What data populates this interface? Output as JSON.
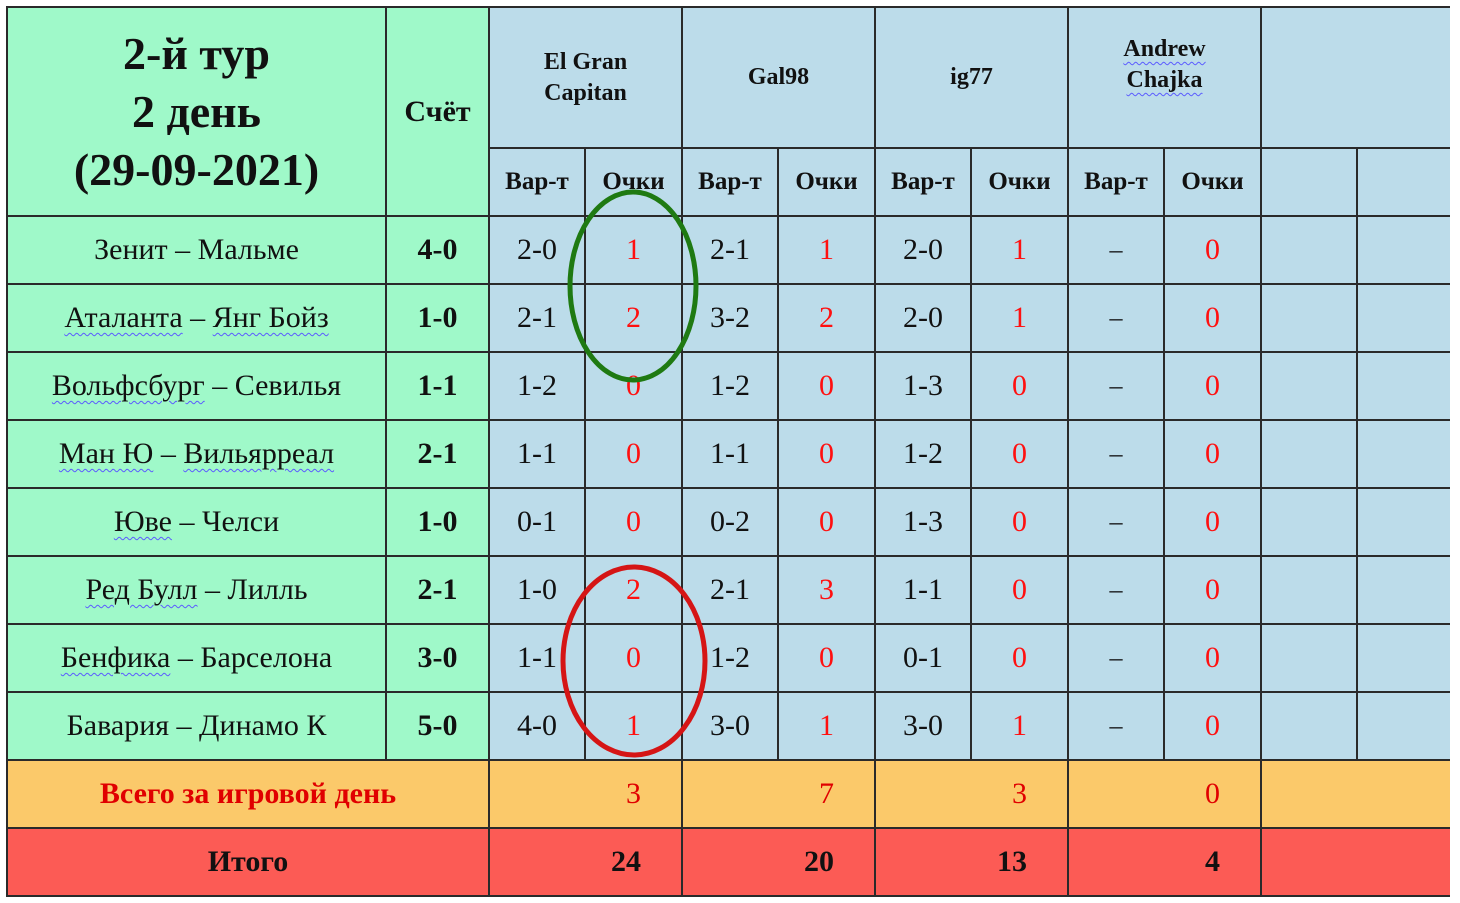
{
  "header": {
    "title_lines": [
      "2-й тур",
      "2 день",
      "(29-09-2021)"
    ],
    "score_label": "Счёт",
    "pred_label": "Вар-т",
    "points_label": "Очки"
  },
  "players": [
    {
      "name_lines": [
        "El Gran",
        "Capitan"
      ],
      "wavy": false
    },
    {
      "name_lines": [
        "Gal98"
      ],
      "wavy": false
    },
    {
      "name_lines": [
        "ig77"
      ],
      "wavy": false
    },
    {
      "name_lines": [
        "Andrew",
        "Chajka"
      ],
      "wavy": true
    }
  ],
  "matches": [
    {
      "home": "Зенит",
      "away": "Мальме",
      "score": "4-0",
      "wavy": [],
      "picks": [
        {
          "p": "2-0",
          "pts": "1"
        },
        {
          "p": "2-1",
          "pts": "1"
        },
        {
          "p": "2-0",
          "pts": "1"
        },
        {
          "p": "–",
          "pts": "0"
        }
      ]
    },
    {
      "home": "Аталанта",
      "away": "Янг Бойз",
      "score": "1-0",
      "wavy": [
        "home",
        "away"
      ],
      "picks": [
        {
          "p": "2-1",
          "pts": "2"
        },
        {
          "p": "3-2",
          "pts": "2"
        },
        {
          "p": "2-0",
          "pts": "1"
        },
        {
          "p": "–",
          "pts": "0"
        }
      ]
    },
    {
      "home": "Вольфсбург",
      "away": "Севилья",
      "score": "1-1",
      "wavy": [
        "home"
      ],
      "picks": [
        {
          "p": "1-2",
          "pts": "0"
        },
        {
          "p": "1-2",
          "pts": "0"
        },
        {
          "p": "1-3",
          "pts": "0"
        },
        {
          "p": "–",
          "pts": "0"
        }
      ]
    },
    {
      "home": "Ман Ю",
      "away": "Вильярреал",
      "score": "2-1",
      "wavy": [
        "home",
        "away"
      ],
      "picks": [
        {
          "p": "1-1",
          "pts": "0"
        },
        {
          "p": "1-1",
          "pts": "0"
        },
        {
          "p": "1-2",
          "pts": "0"
        },
        {
          "p": "–",
          "pts": "0"
        }
      ]
    },
    {
      "home": "Юве",
      "away": "Челси",
      "score": "1-0",
      "wavy": [
        "home"
      ],
      "picks": [
        {
          "p": "0-1",
          "pts": "0"
        },
        {
          "p": "0-2",
          "pts": "0"
        },
        {
          "p": "1-3",
          "pts": "0"
        },
        {
          "p": "–",
          "pts": "0"
        }
      ]
    },
    {
      "home": "Ред Булл",
      "away": "Лилль",
      "score": "2-1",
      "wavy": [
        "home"
      ],
      "picks": [
        {
          "p": "1-0",
          "pts": "2"
        },
        {
          "p": "2-1",
          "pts": "3"
        },
        {
          "p": "1-1",
          "pts": "0"
        },
        {
          "p": "–",
          "pts": "0"
        }
      ]
    },
    {
      "home": "Бенфика",
      "away": "Барселона",
      "score": "3-0",
      "wavy": [
        "home"
      ],
      "picks": [
        {
          "p": "1-1",
          "pts": "0"
        },
        {
          "p": "1-2",
          "pts": "0"
        },
        {
          "p": "0-1",
          "pts": "0"
        },
        {
          "p": "–",
          "pts": "0"
        }
      ]
    },
    {
      "home": "Бавария",
      "away": "Динамо К",
      "score": "5-0",
      "wavy": [],
      "picks": [
        {
          "p": "4-0",
          "pts": "1"
        },
        {
          "p": "3-0",
          "pts": "1"
        },
        {
          "p": "3-0",
          "pts": "1"
        },
        {
          "p": "–",
          "pts": "0"
        }
      ]
    }
  ],
  "day_total": {
    "label": "Всего за игровой день",
    "values": [
      "3",
      "7",
      "3",
      "0"
    ]
  },
  "grand_total": {
    "label": "Итого",
    "values": [
      "24",
      "20",
      "13",
      "4"
    ]
  },
  "colors": {
    "green": "#9ff9c9",
    "blue": "#bcdcea",
    "orange": "#fbc96a",
    "red": "#fc5b55",
    "points_text": "#ff1010",
    "green_circle": "#1f7a12",
    "red_circle": "#d51515"
  },
  "annotations": [
    {
      "shape": "ellipse",
      "color": "green",
      "around": "El Gran Capitan Очки, Зенит – Мальме to Вольфсбург – Севилья"
    },
    {
      "shape": "ellipse",
      "color": "red",
      "around": "El Gran Capitan Очки, Ред Булл – Лилль to Бавария – Динамо К"
    }
  ]
}
